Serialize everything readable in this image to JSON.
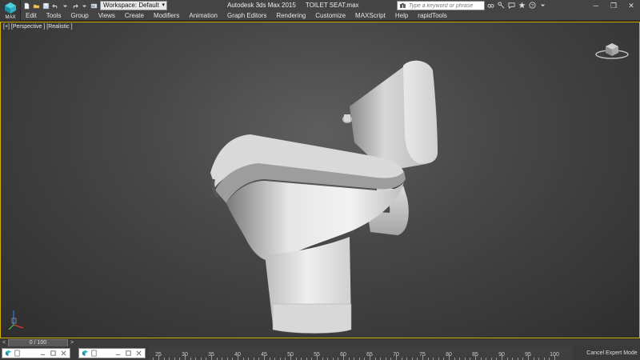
{
  "app": {
    "logo_caption": "MAX",
    "title": "Autodesk 3ds Max  2015",
    "file_name": "TOILET SEAT.max"
  },
  "quick_access": {
    "icons": [
      "new-file-icon",
      "open-folder-icon",
      "save-icon",
      "undo-icon",
      "undo-dropdown-icon",
      "redo-icon",
      "redo-dropdown-icon",
      "project-folder-icon"
    ],
    "workspace_label": "Workspace: Default",
    "workspace_dropdown": "▾"
  },
  "search": {
    "placeholder": "Type a keyword or phrase"
  },
  "help_tools": [
    "binoculars-icon",
    "key-icon",
    "communication-center-icon",
    "favorites-star-icon",
    "help-icon",
    "help-dropdown-icon"
  ],
  "window_controls": {
    "minimize": "─",
    "restore": "❐",
    "close": "✕"
  },
  "menu": {
    "items": [
      "Edit",
      "Tools",
      "Group",
      "Views",
      "Create",
      "Modifiers",
      "Animation",
      "Graph Editors",
      "Rendering",
      "Customize",
      "MAXScript",
      "Help",
      "rapidTools"
    ]
  },
  "viewport": {
    "label": "[+] [Perspective ] [Realistic ]",
    "border_color": "#d4b000",
    "background_center": "#5e5e5e",
    "background_edge": "#2e2e2e"
  },
  "time_slider": {
    "prev": "<",
    "readout": "0 / 100",
    "next": ">"
  },
  "trackbar": {
    "range": [
      0,
      100
    ],
    "labels": [
      "25",
      "30",
      "35",
      "40",
      "45",
      "50",
      "55",
      "60",
      "65",
      "70",
      "75",
      "80",
      "85",
      "90",
      "95",
      "100"
    ],
    "first_label_value": 25
  },
  "status": {
    "expert_mode": "Cancel Expert Mode"
  }
}
